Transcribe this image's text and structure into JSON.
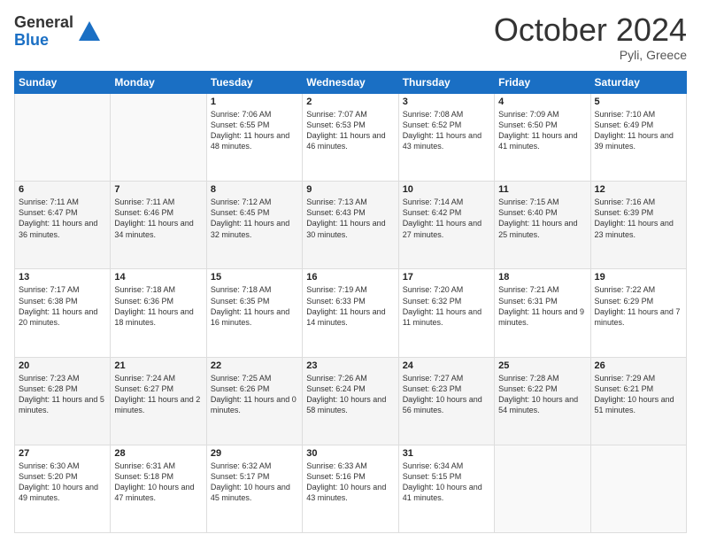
{
  "logo": {
    "general": "General",
    "blue": "Blue"
  },
  "header": {
    "month": "October 2024",
    "location": "Pyli, Greece"
  },
  "days_of_week": [
    "Sunday",
    "Monday",
    "Tuesday",
    "Wednesday",
    "Thursday",
    "Friday",
    "Saturday"
  ],
  "weeks": [
    [
      {
        "day": "",
        "info": ""
      },
      {
        "day": "",
        "info": ""
      },
      {
        "day": "1",
        "info": "Sunrise: 7:06 AM\nSunset: 6:55 PM\nDaylight: 11 hours and 48 minutes."
      },
      {
        "day": "2",
        "info": "Sunrise: 7:07 AM\nSunset: 6:53 PM\nDaylight: 11 hours and 46 minutes."
      },
      {
        "day": "3",
        "info": "Sunrise: 7:08 AM\nSunset: 6:52 PM\nDaylight: 11 hours and 43 minutes."
      },
      {
        "day": "4",
        "info": "Sunrise: 7:09 AM\nSunset: 6:50 PM\nDaylight: 11 hours and 41 minutes."
      },
      {
        "day": "5",
        "info": "Sunrise: 7:10 AM\nSunset: 6:49 PM\nDaylight: 11 hours and 39 minutes."
      }
    ],
    [
      {
        "day": "6",
        "info": "Sunrise: 7:11 AM\nSunset: 6:47 PM\nDaylight: 11 hours and 36 minutes."
      },
      {
        "day": "7",
        "info": "Sunrise: 7:11 AM\nSunset: 6:46 PM\nDaylight: 11 hours and 34 minutes."
      },
      {
        "day": "8",
        "info": "Sunrise: 7:12 AM\nSunset: 6:45 PM\nDaylight: 11 hours and 32 minutes."
      },
      {
        "day": "9",
        "info": "Sunrise: 7:13 AM\nSunset: 6:43 PM\nDaylight: 11 hours and 30 minutes."
      },
      {
        "day": "10",
        "info": "Sunrise: 7:14 AM\nSunset: 6:42 PM\nDaylight: 11 hours and 27 minutes."
      },
      {
        "day": "11",
        "info": "Sunrise: 7:15 AM\nSunset: 6:40 PM\nDaylight: 11 hours and 25 minutes."
      },
      {
        "day": "12",
        "info": "Sunrise: 7:16 AM\nSunset: 6:39 PM\nDaylight: 11 hours and 23 minutes."
      }
    ],
    [
      {
        "day": "13",
        "info": "Sunrise: 7:17 AM\nSunset: 6:38 PM\nDaylight: 11 hours and 20 minutes."
      },
      {
        "day": "14",
        "info": "Sunrise: 7:18 AM\nSunset: 6:36 PM\nDaylight: 11 hours and 18 minutes."
      },
      {
        "day": "15",
        "info": "Sunrise: 7:18 AM\nSunset: 6:35 PM\nDaylight: 11 hours and 16 minutes."
      },
      {
        "day": "16",
        "info": "Sunrise: 7:19 AM\nSunset: 6:33 PM\nDaylight: 11 hours and 14 minutes."
      },
      {
        "day": "17",
        "info": "Sunrise: 7:20 AM\nSunset: 6:32 PM\nDaylight: 11 hours and 11 minutes."
      },
      {
        "day": "18",
        "info": "Sunrise: 7:21 AM\nSunset: 6:31 PM\nDaylight: 11 hours and 9 minutes."
      },
      {
        "day": "19",
        "info": "Sunrise: 7:22 AM\nSunset: 6:29 PM\nDaylight: 11 hours and 7 minutes."
      }
    ],
    [
      {
        "day": "20",
        "info": "Sunrise: 7:23 AM\nSunset: 6:28 PM\nDaylight: 11 hours and 5 minutes."
      },
      {
        "day": "21",
        "info": "Sunrise: 7:24 AM\nSunset: 6:27 PM\nDaylight: 11 hours and 2 minutes."
      },
      {
        "day": "22",
        "info": "Sunrise: 7:25 AM\nSunset: 6:26 PM\nDaylight: 11 hours and 0 minutes."
      },
      {
        "day": "23",
        "info": "Sunrise: 7:26 AM\nSunset: 6:24 PM\nDaylight: 10 hours and 58 minutes."
      },
      {
        "day": "24",
        "info": "Sunrise: 7:27 AM\nSunset: 6:23 PM\nDaylight: 10 hours and 56 minutes."
      },
      {
        "day": "25",
        "info": "Sunrise: 7:28 AM\nSunset: 6:22 PM\nDaylight: 10 hours and 54 minutes."
      },
      {
        "day": "26",
        "info": "Sunrise: 7:29 AM\nSunset: 6:21 PM\nDaylight: 10 hours and 51 minutes."
      }
    ],
    [
      {
        "day": "27",
        "info": "Sunrise: 6:30 AM\nSunset: 5:20 PM\nDaylight: 10 hours and 49 minutes."
      },
      {
        "day": "28",
        "info": "Sunrise: 6:31 AM\nSunset: 5:18 PM\nDaylight: 10 hours and 47 minutes."
      },
      {
        "day": "29",
        "info": "Sunrise: 6:32 AM\nSunset: 5:17 PM\nDaylight: 10 hours and 45 minutes."
      },
      {
        "day": "30",
        "info": "Sunrise: 6:33 AM\nSunset: 5:16 PM\nDaylight: 10 hours and 43 minutes."
      },
      {
        "day": "31",
        "info": "Sunrise: 6:34 AM\nSunset: 5:15 PM\nDaylight: 10 hours and 41 minutes."
      },
      {
        "day": "",
        "info": ""
      },
      {
        "day": "",
        "info": ""
      }
    ]
  ]
}
